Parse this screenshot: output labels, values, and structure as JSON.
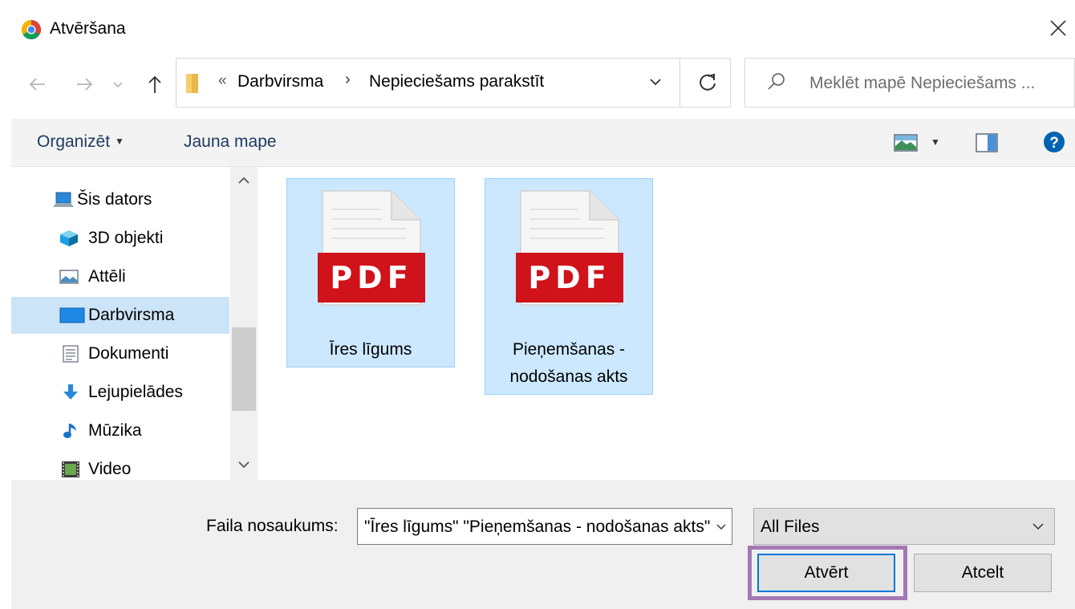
{
  "window": {
    "title": "Atvēršana",
    "icons": {
      "app": "chrome-icon",
      "close": "close-icon"
    }
  },
  "navigation": {
    "breadcrumb_prefix": "«",
    "breadcrumbs": [
      "Darbvirsma",
      "Nepieciešams parakstīt"
    ],
    "breadcrumb_separator": "›",
    "search_placeholder": "Meklēt mapē Nepieciešams ..."
  },
  "toolbar": {
    "organize_label": "Organizēt",
    "new_folder_label": "Jauna mape"
  },
  "sidebar": {
    "items": [
      {
        "label": "Šis dators",
        "icon": "computer-icon",
        "selected": false
      },
      {
        "label": "3D objekti",
        "icon": "cube-icon",
        "selected": false
      },
      {
        "label": "Attēli",
        "icon": "pictures-icon",
        "selected": false
      },
      {
        "label": "Darbvirsma",
        "icon": "desktop-icon",
        "selected": true
      },
      {
        "label": "Dokumenti",
        "icon": "documents-icon",
        "selected": false
      },
      {
        "label": "Lejupielādes",
        "icon": "download-icon",
        "selected": false
      },
      {
        "label": "Mūzika",
        "icon": "music-icon",
        "selected": false
      },
      {
        "label": "Video",
        "icon": "video-icon",
        "selected": false
      }
    ]
  },
  "files": [
    {
      "name": "Īres līgums",
      "badge": "PDF",
      "selected": true
    },
    {
      "name": "Pieņemšanas - nodošanas akts",
      "badge": "PDF",
      "selected": true
    }
  ],
  "footer": {
    "filename_label": "Faila nosaukums:",
    "filename_value": "\"Īres līgums\" \"Pieņemšanas - nodošanas akts\"",
    "filter_value": "All Files",
    "open_button": "Atvērt",
    "cancel_button": "Atcelt"
  },
  "colors": {
    "selection": "#cce8ff",
    "pdf_badge": "#d0121b",
    "highlight_box": "#a478b4",
    "help_icon": "#0063b1"
  }
}
